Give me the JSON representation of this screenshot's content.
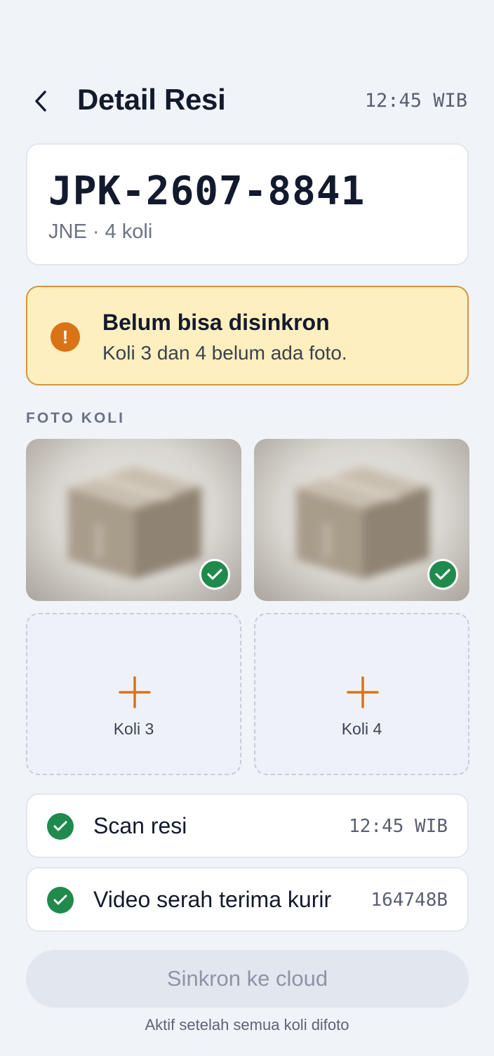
{
  "header": {
    "title": "Detail Resi",
    "time": "12:45 WIB"
  },
  "resi": {
    "number": "JPK-2607-8841",
    "subtitle": "JNE · 4 koli"
  },
  "warning": {
    "title": "Belum bisa disinkron",
    "message": "Koli 3 dan 4 belum ada foto.",
    "icon": "exclamation-icon",
    "color": "#d97316"
  },
  "photos": {
    "section_label": "FOTO KOLI",
    "tiles": [
      {
        "state": "captured",
        "icon": "check-icon"
      },
      {
        "state": "captured",
        "icon": "check-icon"
      },
      {
        "state": "empty",
        "label": "Koli 3",
        "icon": "plus-icon"
      },
      {
        "state": "empty",
        "label": "Koli 4",
        "icon": "plus-icon"
      }
    ]
  },
  "steps": [
    {
      "label": "Scan resi",
      "value": "12:45 WIB",
      "done": true
    },
    {
      "label": "Video serah terima kurir",
      "value": "164748B",
      "done": true
    }
  ],
  "sync": {
    "button_label": "Sinkron ke cloud",
    "hint": "Aktif setelah semua koli difoto",
    "enabled": false
  },
  "colors": {
    "accent": "#d97316",
    "success": "#1f8a4c",
    "warning_bg": "#fdefbf",
    "warning_border": "#d9923e"
  }
}
